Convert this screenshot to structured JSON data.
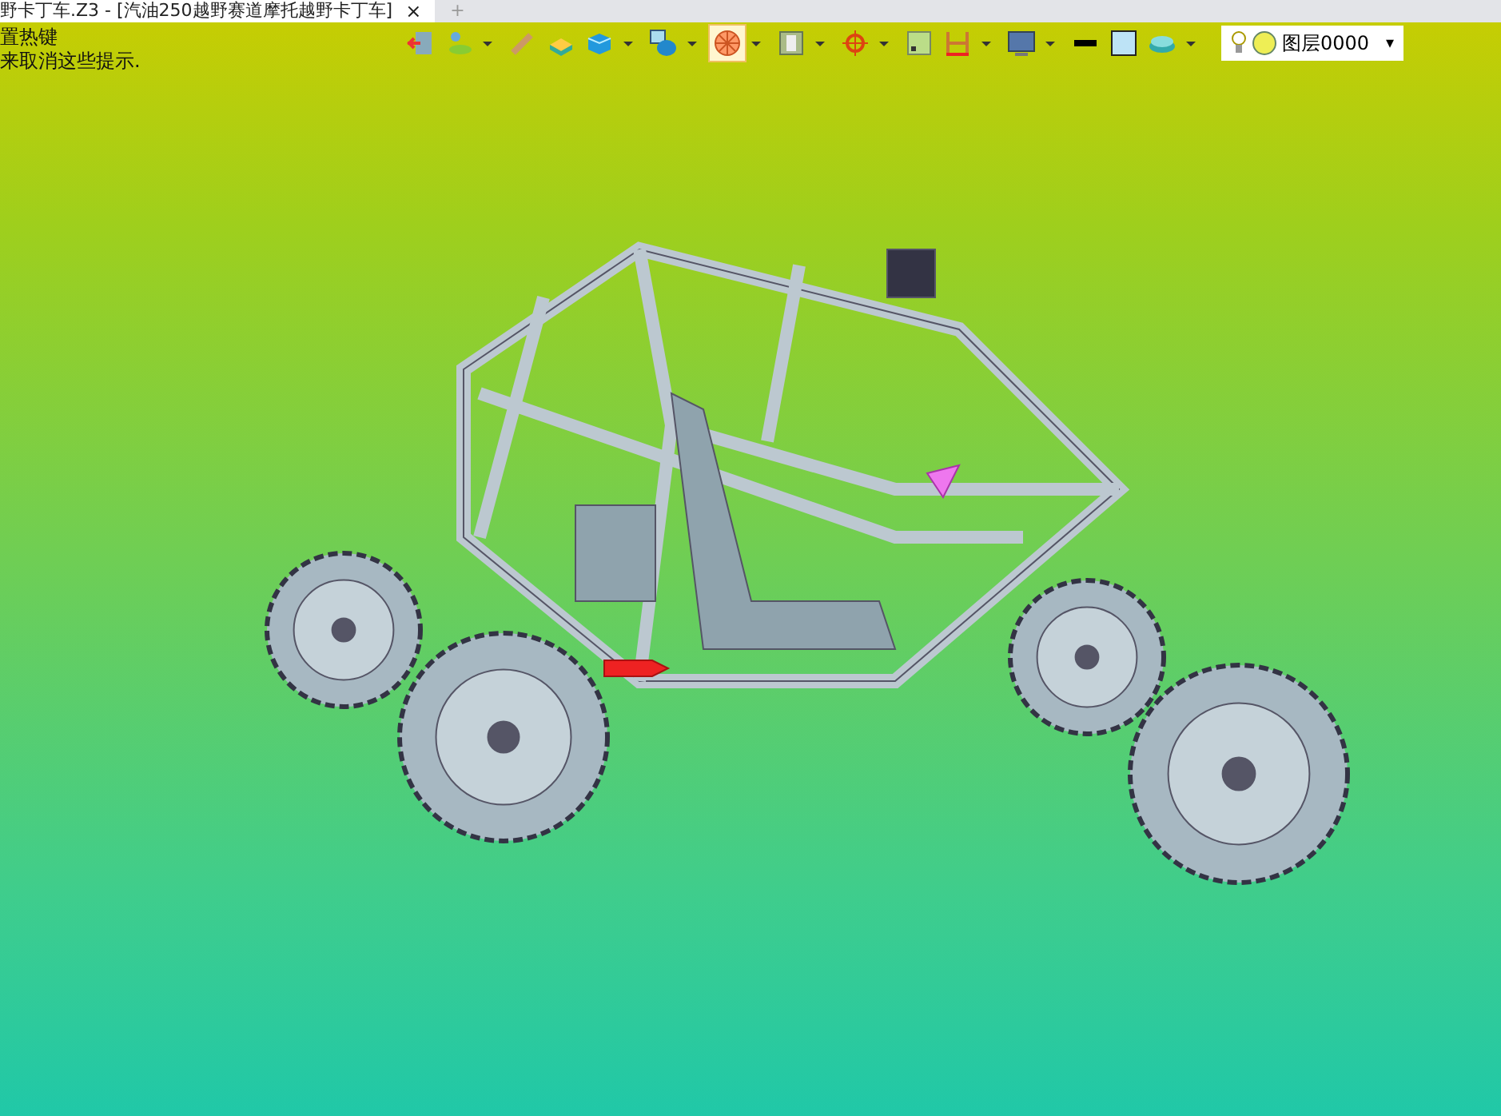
{
  "tabs": [
    {
      "label": "野卡丁车.Z3 - [汽油250越野赛道摩托越野卡丁车]",
      "selected": true,
      "close": "×"
    },
    {
      "label": "+",
      "selected": false
    }
  ],
  "hints": [
    "置热键",
    "来取消这些提示."
  ],
  "toolbar": [
    {
      "dropdown": false,
      "selected": false
    },
    {
      "dropdown": true,
      "selected": false
    },
    {
      "dropdown": false,
      "selected": false
    },
    {
      "dropdown": false,
      "selected": false
    },
    {
      "dropdown": true,
      "selected": false
    },
    {
      "dropdown": true,
      "selected": false
    },
    {
      "dropdown": true,
      "selected": true
    },
    {
      "dropdown": true,
      "selected": false
    },
    {
      "dropdown": true,
      "selected": false
    },
    {
      "dropdown": false,
      "selected": false
    },
    {
      "dropdown": true,
      "selected": false
    },
    {
      "dropdown": true,
      "selected": false
    },
    {
      "dropdown": false,
      "selected": false
    },
    {
      "dropdown": false,
      "selected": false
    },
    {
      "dropdown": true,
      "selected": false
    }
  ],
  "layer_combo": {
    "value": "图层0000",
    "caret": "▾"
  }
}
